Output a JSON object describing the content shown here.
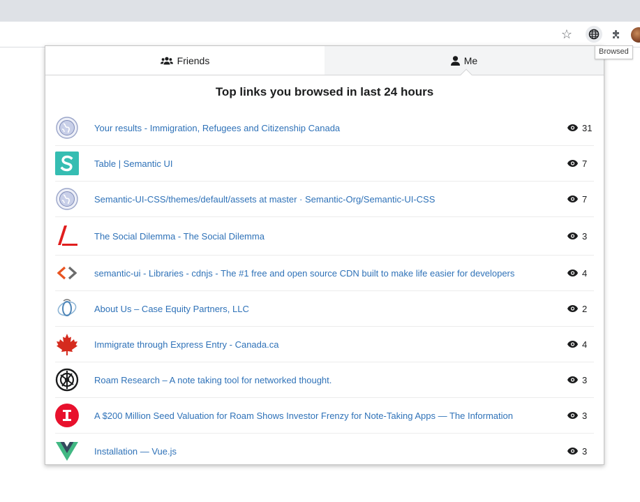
{
  "browser": {
    "toolbar_icons": [
      "star-icon",
      "globe-icon",
      "puzzle-icon",
      "avatar"
    ],
    "tooltip": "Browsed"
  },
  "popup": {
    "tabs": [
      {
        "label": "Friends",
        "icon": "friends-icon",
        "active": false
      },
      {
        "label": "Me",
        "icon": "user-icon",
        "active": true
      }
    ],
    "heading": "Top links you browsed in last 24 hours",
    "links": [
      {
        "title": "Your results - Immigration, Refugees and Citizenship Canada",
        "count": "31",
        "favicon": "globe"
      },
      {
        "title": "Table | Semantic UI",
        "count": "7",
        "favicon": "semantic-s"
      },
      {
        "title": "Semantic-UI-CSS/themes/default/assets at master · Semantic-Org/Semantic-UI-CSS",
        "count": "7",
        "favicon": "globe"
      },
      {
        "title": "The Social Dilemma - The Social Dilemma",
        "count": "3",
        "favicon": "social-dilemma"
      },
      {
        "title": "semantic-ui - Libraries - cdnjs - The #1 free and open source CDN built to make life easier for developers",
        "count": "4",
        "favicon": "cdnjs"
      },
      {
        "title": "About Us – Case Equity Partners, LLC",
        "count": "2",
        "favicon": "case-equity"
      },
      {
        "title": "Immigrate through Express Entry - Canada.ca",
        "count": "4",
        "favicon": "maple-leaf"
      },
      {
        "title": "Roam Research – A note taking tool for networked thought.",
        "count": "3",
        "favicon": "roam"
      },
      {
        "title": "A $200 Million Seed Valuation for Roam Shows Investor Frenzy for Note-Taking Apps — The Information",
        "count": "3",
        "favicon": "the-information"
      },
      {
        "title": "Installation — Vue.js",
        "count": "3",
        "favicon": "vue"
      }
    ]
  },
  "colors": {
    "link": "#2f72b8",
    "semantic": "#35bdb2",
    "information_red": "#e8112d",
    "vue_green": "#41b883",
    "vue_dark": "#35495e"
  }
}
